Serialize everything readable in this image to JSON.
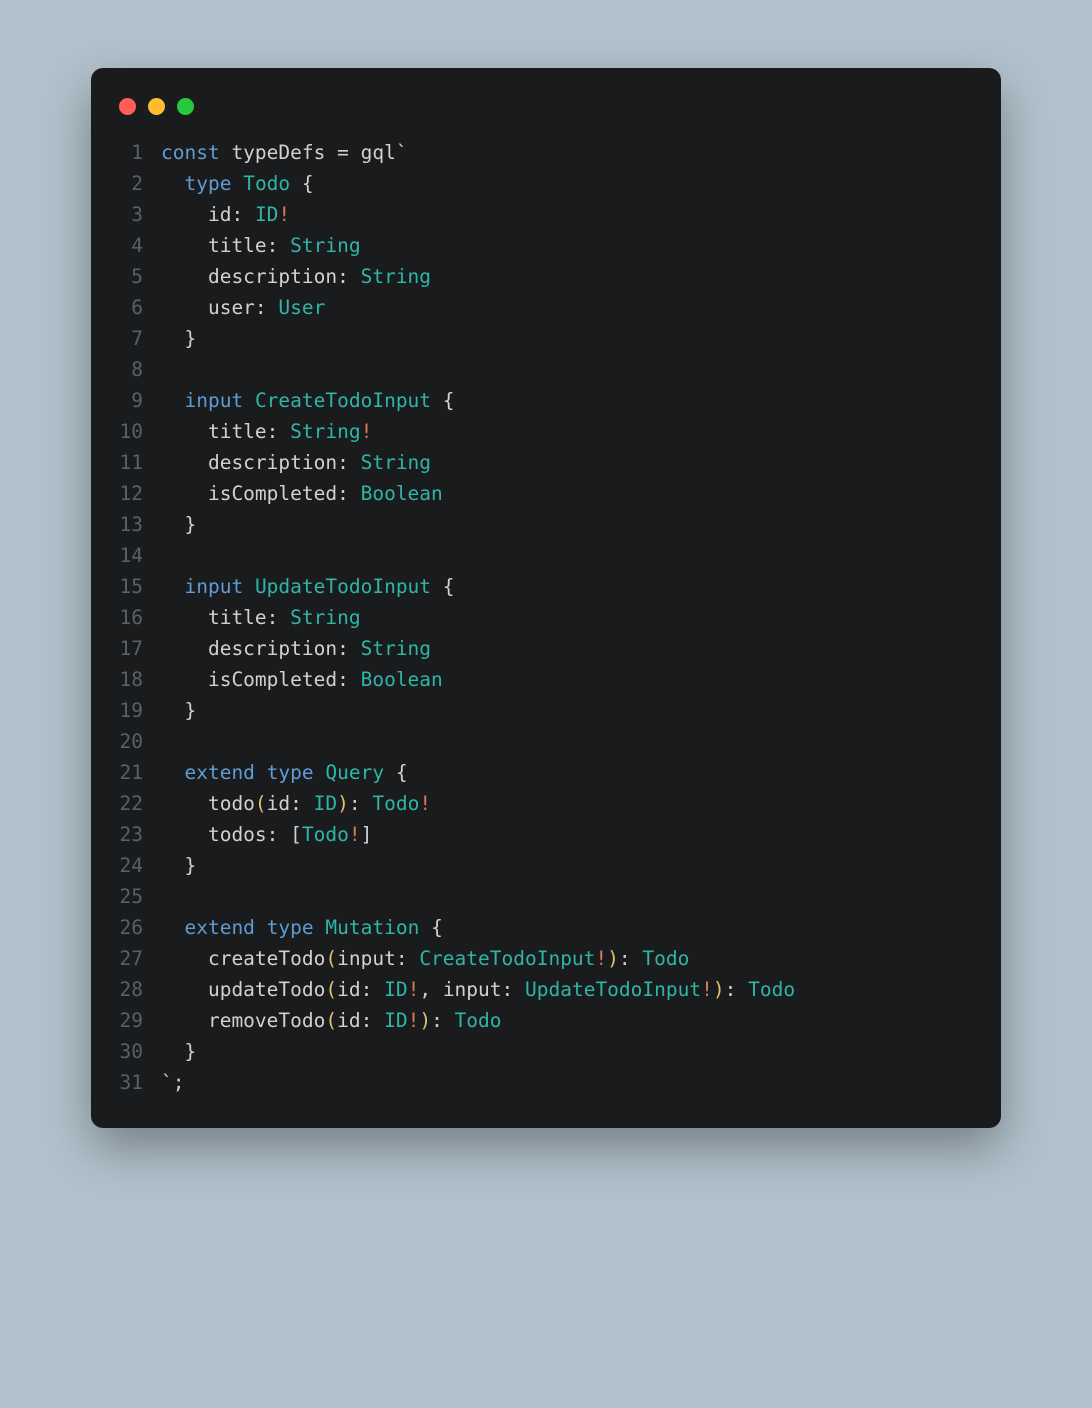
{
  "window": {
    "traffic": [
      "red",
      "yellow",
      "green"
    ]
  },
  "code": {
    "lines": [
      {
        "n": 1,
        "tokens": [
          [
            "kw",
            "const"
          ],
          [
            "ident",
            " typeDefs "
          ],
          [
            "punct",
            "="
          ],
          [
            "ident",
            " gql"
          ],
          [
            "punct",
            "`"
          ]
        ]
      },
      {
        "n": 2,
        "tokens": [
          [
            "ident",
            "  "
          ],
          [
            "kw",
            "type"
          ],
          [
            "ident",
            " "
          ],
          [
            "teal",
            "Todo"
          ],
          [
            "ident",
            " "
          ],
          [
            "punct",
            "{"
          ]
        ]
      },
      {
        "n": 3,
        "tokens": [
          [
            "ident",
            "    id"
          ],
          [
            "punct",
            ": "
          ],
          [
            "teal",
            "ID"
          ],
          [
            "bang",
            "!"
          ]
        ]
      },
      {
        "n": 4,
        "tokens": [
          [
            "ident",
            "    title"
          ],
          [
            "punct",
            ": "
          ],
          [
            "teal",
            "String"
          ]
        ]
      },
      {
        "n": 5,
        "tokens": [
          [
            "ident",
            "    description"
          ],
          [
            "punct",
            ": "
          ],
          [
            "teal",
            "String"
          ]
        ]
      },
      {
        "n": 6,
        "tokens": [
          [
            "ident",
            "    user"
          ],
          [
            "punct",
            ": "
          ],
          [
            "teal",
            "User"
          ]
        ]
      },
      {
        "n": 7,
        "tokens": [
          [
            "ident",
            "  "
          ],
          [
            "punct",
            "}"
          ]
        ]
      },
      {
        "n": 8,
        "tokens": [
          [
            "ident",
            ""
          ]
        ]
      },
      {
        "n": 9,
        "tokens": [
          [
            "ident",
            "  "
          ],
          [
            "kw",
            "input"
          ],
          [
            "ident",
            " "
          ],
          [
            "teal",
            "CreateTodoInput"
          ],
          [
            "ident",
            " "
          ],
          [
            "punct",
            "{"
          ]
        ]
      },
      {
        "n": 10,
        "tokens": [
          [
            "ident",
            "    title"
          ],
          [
            "punct",
            ": "
          ],
          [
            "teal",
            "String"
          ],
          [
            "bang",
            "!"
          ]
        ]
      },
      {
        "n": 11,
        "tokens": [
          [
            "ident",
            "    description"
          ],
          [
            "punct",
            ": "
          ],
          [
            "teal",
            "String"
          ]
        ]
      },
      {
        "n": 12,
        "tokens": [
          [
            "ident",
            "    isCompleted"
          ],
          [
            "punct",
            ": "
          ],
          [
            "teal",
            "Boolean"
          ]
        ]
      },
      {
        "n": 13,
        "tokens": [
          [
            "ident",
            "  "
          ],
          [
            "punct",
            "}"
          ]
        ]
      },
      {
        "n": 14,
        "tokens": [
          [
            "ident",
            ""
          ]
        ]
      },
      {
        "n": 15,
        "tokens": [
          [
            "ident",
            "  "
          ],
          [
            "kw",
            "input"
          ],
          [
            "ident",
            " "
          ],
          [
            "teal",
            "UpdateTodoInput"
          ],
          [
            "ident",
            " "
          ],
          [
            "punct",
            "{"
          ]
        ]
      },
      {
        "n": 16,
        "tokens": [
          [
            "ident",
            "    title"
          ],
          [
            "punct",
            ": "
          ],
          [
            "teal",
            "String"
          ]
        ]
      },
      {
        "n": 17,
        "tokens": [
          [
            "ident",
            "    description"
          ],
          [
            "punct",
            ": "
          ],
          [
            "teal",
            "String"
          ]
        ]
      },
      {
        "n": 18,
        "tokens": [
          [
            "ident",
            "    isCompleted"
          ],
          [
            "punct",
            ": "
          ],
          [
            "teal",
            "Boolean"
          ]
        ]
      },
      {
        "n": 19,
        "tokens": [
          [
            "ident",
            "  "
          ],
          [
            "punct",
            "}"
          ]
        ]
      },
      {
        "n": 20,
        "tokens": [
          [
            "ident",
            ""
          ]
        ]
      },
      {
        "n": 21,
        "tokens": [
          [
            "ident",
            "  "
          ],
          [
            "kw",
            "extend"
          ],
          [
            "ident",
            " "
          ],
          [
            "kw",
            "type"
          ],
          [
            "ident",
            " "
          ],
          [
            "teal",
            "Query"
          ],
          [
            "ident",
            " "
          ],
          [
            "punct",
            "{"
          ]
        ]
      },
      {
        "n": 22,
        "tokens": [
          [
            "ident",
            "    todo"
          ],
          [
            "paren",
            "("
          ],
          [
            "ident",
            "id"
          ],
          [
            "punct",
            ": "
          ],
          [
            "teal",
            "ID"
          ],
          [
            "paren",
            ")"
          ],
          [
            "punct",
            ": "
          ],
          [
            "teal",
            "Todo"
          ],
          [
            "bang",
            "!"
          ]
        ]
      },
      {
        "n": 23,
        "tokens": [
          [
            "ident",
            "    todos"
          ],
          [
            "punct",
            ": ["
          ],
          [
            "teal",
            "Todo"
          ],
          [
            "bang",
            "!"
          ],
          [
            "punct",
            "]"
          ]
        ]
      },
      {
        "n": 24,
        "tokens": [
          [
            "ident",
            "  "
          ],
          [
            "punct",
            "}"
          ]
        ]
      },
      {
        "n": 25,
        "tokens": [
          [
            "ident",
            ""
          ]
        ]
      },
      {
        "n": 26,
        "tokens": [
          [
            "ident",
            "  "
          ],
          [
            "kw",
            "extend"
          ],
          [
            "ident",
            " "
          ],
          [
            "kw",
            "type"
          ],
          [
            "ident",
            " "
          ],
          [
            "teal",
            "Mutation"
          ],
          [
            "ident",
            " "
          ],
          [
            "punct",
            "{"
          ]
        ]
      },
      {
        "n": 27,
        "tokens": [
          [
            "ident",
            "    createTodo"
          ],
          [
            "paren",
            "("
          ],
          [
            "ident",
            "input"
          ],
          [
            "punct",
            ": "
          ],
          [
            "teal",
            "CreateTodoInput"
          ],
          [
            "bang",
            "!"
          ],
          [
            "paren",
            ")"
          ],
          [
            "punct",
            ": "
          ],
          [
            "teal",
            "Todo"
          ]
        ]
      },
      {
        "n": 28,
        "tokens": [
          [
            "ident",
            "    updateTodo"
          ],
          [
            "paren",
            "("
          ],
          [
            "ident",
            "id"
          ],
          [
            "punct",
            ": "
          ],
          [
            "teal",
            "ID"
          ],
          [
            "bang",
            "!"
          ],
          [
            "punct",
            ", "
          ],
          [
            "ident",
            "input"
          ],
          [
            "punct",
            ": "
          ],
          [
            "teal",
            "UpdateTodoInput"
          ],
          [
            "bang",
            "!"
          ],
          [
            "paren",
            ")"
          ],
          [
            "punct",
            ": "
          ],
          [
            "teal",
            "Todo"
          ]
        ]
      },
      {
        "n": 29,
        "tokens": [
          [
            "ident",
            "    removeTodo"
          ],
          [
            "paren",
            "("
          ],
          [
            "ident",
            "id"
          ],
          [
            "punct",
            ": "
          ],
          [
            "teal",
            "ID"
          ],
          [
            "bang",
            "!"
          ],
          [
            "paren",
            ")"
          ],
          [
            "punct",
            ": "
          ],
          [
            "teal",
            "Todo"
          ]
        ]
      },
      {
        "n": 30,
        "tokens": [
          [
            "ident",
            "  "
          ],
          [
            "punct",
            "}"
          ]
        ]
      },
      {
        "n": 31,
        "tokens": [
          [
            "punct",
            "`;"
          ]
        ]
      }
    ]
  }
}
